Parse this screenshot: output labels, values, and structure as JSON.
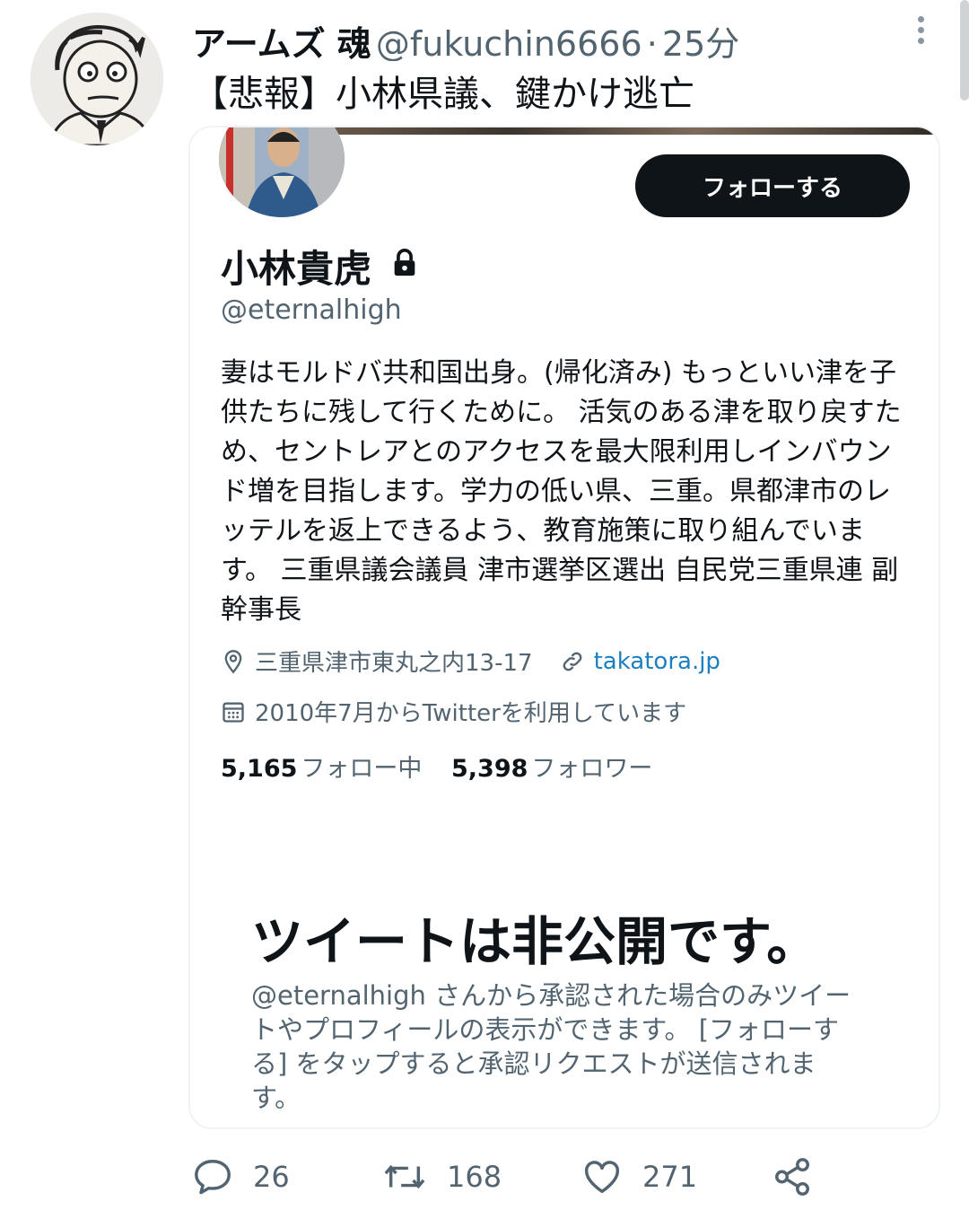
{
  "tweet": {
    "author_name": "アームズ 魂",
    "author_handle": "@fukuchin6666",
    "separator": "·",
    "time": "25分",
    "text": "【悲報】小林県議、鍵かけ逃亡"
  },
  "profile_card": {
    "follow_button": "フォローする",
    "name": "小林貴虎",
    "handle": "@eternalhigh",
    "bio_lines": [
      "妻はモルドバ共和国出身。(帰化済み) もっといい津を子",
      "供たちに残して行くために。 活気のある津を取り戻すた",
      "め、セントレアとのアクセスを最大限利用しインバウン",
      "ド増を目指します。学力の低い県、三重。県都津市のレ",
      "ッテルを返上できるよう、教育施策に取り組んでいま",
      "す。 三重県議会議員 津市選挙区選出 自民党三重県連 副",
      "幹事長"
    ],
    "location": "三重県津市東丸之内13-17",
    "website": "takatora.jp",
    "joined": "2010年7月からTwitterを利用しています",
    "following_count": "5,165",
    "following_label": "フォロー中",
    "followers_count": "5,398",
    "followers_label": "フォロワー",
    "private_title": "ツイートは非公開です。",
    "private_desc_lines": [
      "@eternalhigh さんから承認された場合のみツイー",
      "トやプロフィールの表示ができます。 [フォローす",
      "る] をタップすると承認リクエストが送信されま",
      "す。"
    ]
  },
  "actions": {
    "replies": "26",
    "retweets": "168",
    "likes": "271"
  },
  "icons": {
    "location": "map-pin-icon",
    "website": "link-icon",
    "joined": "calendar-icon",
    "lock": "lock-icon",
    "reply": "reply-icon",
    "retweet": "retweet-icon",
    "like": "heart-icon",
    "share": "share-icon",
    "more": "more-vertical-icon"
  },
  "colors": {
    "text": "#0f1419",
    "muted": "#536471",
    "link": "#1d7fc0",
    "button": "#0f1419",
    "border": "#eff3f4"
  }
}
